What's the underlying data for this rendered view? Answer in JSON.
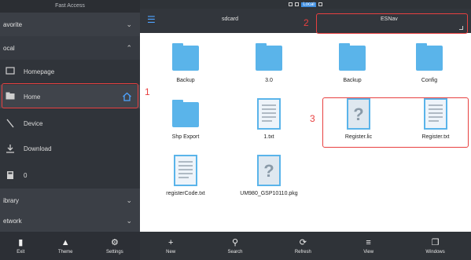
{
  "sidebar": {
    "title": "Fast Access",
    "sections": {
      "favorite": "avorite",
      "local": "ocal",
      "library": "ibrary",
      "network": "etwork"
    },
    "items": [
      {
        "label": "Homepage"
      },
      {
        "label": "Home"
      },
      {
        "label": "Device"
      },
      {
        "label": "Download"
      },
      {
        "label": "0"
      }
    ],
    "bottom_buttons": [
      {
        "label": "Exit"
      },
      {
        "label": "Theme"
      },
      {
        "label": "Settings"
      }
    ]
  },
  "statusbar": {
    "label": "Local"
  },
  "toolbar": {
    "path_root": "sdcard",
    "path_current": "ESNav"
  },
  "files": [
    {
      "name": "Backup",
      "type": "folder"
    },
    {
      "name": "3.0",
      "type": "folder"
    },
    {
      "name": "Backup",
      "type": "folder"
    },
    {
      "name": "Config",
      "type": "folder"
    },
    {
      "name": "Shp Export",
      "type": "folder"
    },
    {
      "name": "1.txt",
      "type": "text"
    },
    {
      "name": "Register.lic",
      "type": "unknown"
    },
    {
      "name": "Register.txt",
      "type": "text"
    },
    {
      "name": "registerCode.txt",
      "type": "text"
    },
    {
      "name": "UM980_GSP10110.pkg",
      "type": "unknown"
    }
  ],
  "bottombar": [
    {
      "label": "New"
    },
    {
      "label": "Search"
    },
    {
      "label": "Refresh"
    },
    {
      "label": "View"
    },
    {
      "label": "Windows"
    }
  ],
  "annotations": [
    "1",
    "2",
    "3"
  ],
  "colors": {
    "folder": "#5ab4ea",
    "accent": "#4ea3ff",
    "annotation": "#e84040"
  }
}
